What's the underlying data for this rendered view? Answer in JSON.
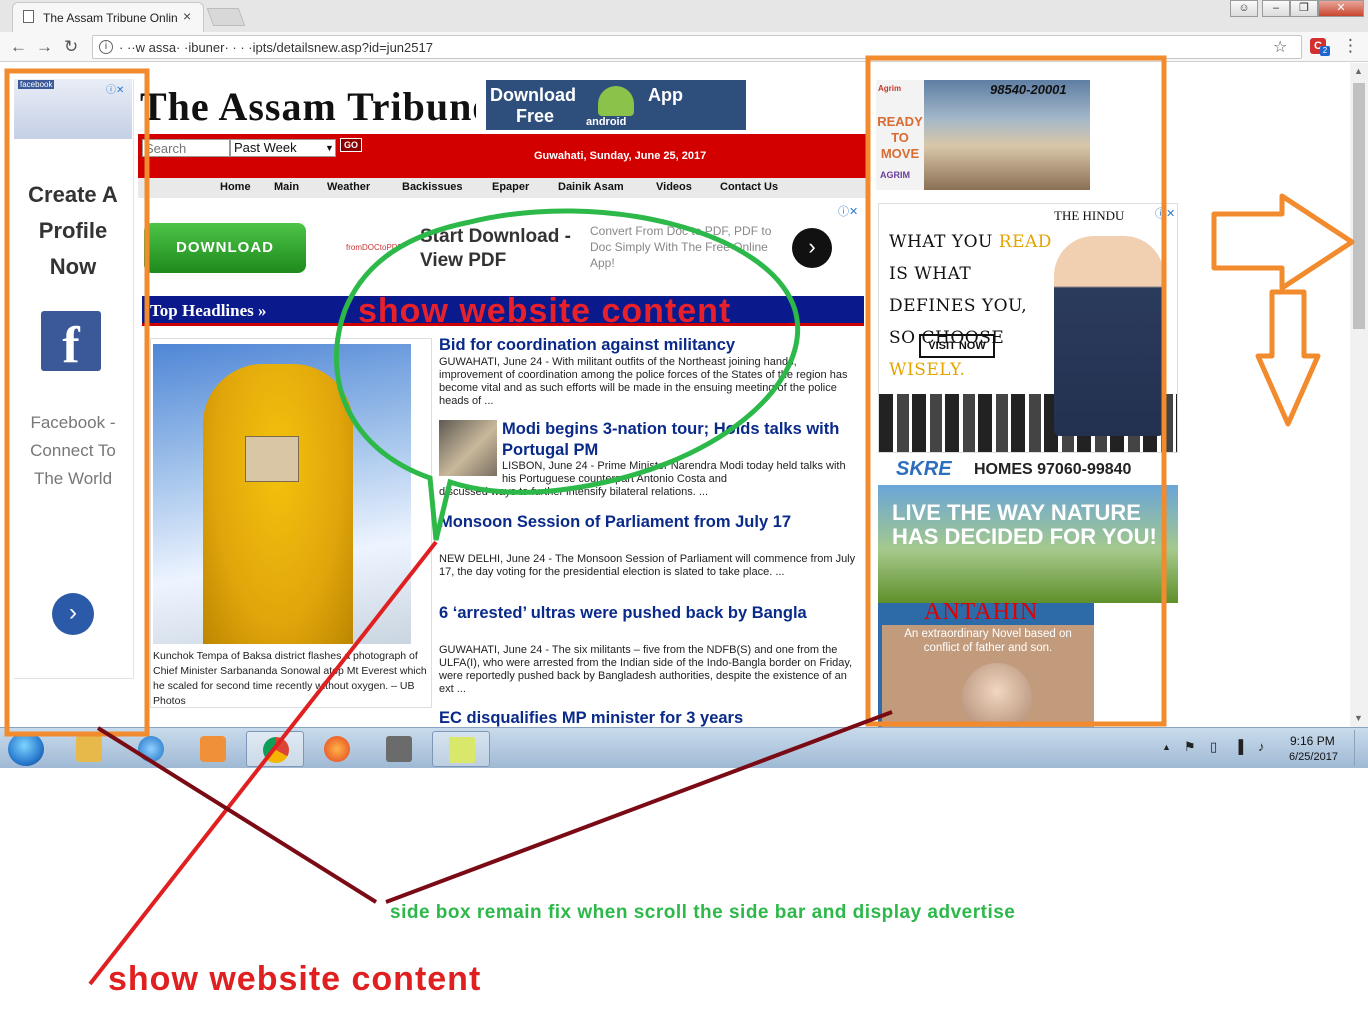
{
  "browser": {
    "tab_title": "The Assam Tribune Onlin",
    "url": "· ··w assa· ·ibuner· · · ·ipts/detailsnew.asp?id=jun2517",
    "tab_close": "×",
    "back": "←",
    "forward": "→",
    "reload": "↻",
    "info": "i",
    "star": "☆",
    "menu": "⋮",
    "ext_label": "C",
    "ext_badge": "2",
    "win_user": "☺",
    "win_min": "–",
    "win_max": "❐",
    "win_close": "✕"
  },
  "left_ad": {
    "brand": "facebook",
    "headline": "Create A Profile Now",
    "logo_letter": "f",
    "caption": "Facebook - Connect To The World",
    "adchoice": "ⓘ✕",
    "next": "›"
  },
  "masthead": {
    "logo": "The Assam Tribune",
    "app_download": "Download",
    "app_free": "Free",
    "app_app": "App",
    "app_android": "android",
    "search_placeholder": "Search",
    "period_selected": "Past Week",
    "period_arrow": "▼",
    "go_label": "GO",
    "dateline": "Guwahati, Sunday, June 25, 2017"
  },
  "nav": [
    "Home",
    "Main",
    "Weather",
    "Backissues",
    "Epaper",
    "Dainik Asam",
    "Videos",
    "Contact Us"
  ],
  "download_ad": {
    "button": "DOWNLOAD",
    "logo": "fromDOCtoPDF",
    "title": "Start Download - View PDF",
    "subtitle": "Convert From Doc to PDF, PDF to Doc Simply With The Free Online App!",
    "next": "›",
    "adchoice": "ⓘ✕"
  },
  "headlines_label": "Top Headlines »",
  "photo_caption": "Kunchok Tempa of Baksa district flashes a photograph of Chief Minister Sarbananda Sonowal atop Mt Everest which he scaled for second time recently without oxygen. – UB Photos",
  "stories": [
    {
      "title": "Bid for coordination against militancy",
      "body": "GUWAHATI, June 24 - With militant outfits of the Northeast joining hands, improvement of coordination among the police forces of the States of the region has become vital and as such efforts will be made in the ensuing meeting of the police heads of ..."
    },
    {
      "title": "Modi begins 3-nation tour; Holds talks with Portugal PM",
      "body": "LISBON, June 24 - Prime Minister Narendra Modi today held talks with his Portuguese counterpart Antonio Costa and",
      "body2": "discussed ways to further intensify bilateral relations. ..."
    },
    {
      "title": "Monsoon Session of Parliament from July 17",
      "body": "NEW DELHI, June 24 - The Monsoon Session of Parliament will commence from July 17, the day voting for the presidential election is slated to take place. ..."
    },
    {
      "title": "6 ‘arrested’ ultras were pushed back by Bangla",
      "body": "GUWAHATI, June 24 - The six militants – five from the NDFB(S) and one from the ULFA(I), who were arrested from the Indian side of the Indo-Bangla border on Friday, were reportedly pushed back by Bangladesh authorities, despite the existence of an ext ..."
    },
    {
      "title": "EC disqualifies MP minister for 3 years"
    }
  ],
  "right_ads": {
    "agrim_logo": "Agrim",
    "agrim_ready": "READY TO MOVE",
    "agrim_phone": "98540-20001",
    "agrim_brand": "AGRIM",
    "hindu_logo": "THE HINDU",
    "hindu_adchoice": "ⓘ✕",
    "hindu_w1": "WHAT YOU ",
    "hindu_w2": "READ",
    "hindu_w3": " IS WHAT DEFINES YOU, SO CHOOSE ",
    "hindu_w4": "WISELY.",
    "hindu_visit": "VISIT NOW",
    "skre_logo": "SKRE",
    "skre_text": "HOMES  97060-99840",
    "nature_text": "LIVE THE WAY NATURE HAS DECIDED FOR YOU!",
    "novel_title": "ANTAHIN",
    "novel_desc": "An extraordinary Novel based on conflict of father and son."
  },
  "taskbar": {
    "time": "9:16 PM",
    "date": "6/25/2017",
    "tray_up": "▲",
    "tray_flag": "⚑",
    "tray_battery": "▯",
    "tray_signal": "▐",
    "tray_volume": "♪"
  },
  "scroll": {
    "up": "▲",
    "down": "▼"
  },
  "annotations": {
    "green_label": "side box remain fix when scroll the side bar and display advertise",
    "red_label": "show website content",
    "red_label_top": "show website content"
  },
  "colors": {
    "annotation_orange": "#f28a2e",
    "annotation_green": "#2db84a",
    "annotation_red": "#e02020",
    "annotation_darkred": "#7a0a14",
    "masthead_red": "#d30000",
    "headline_navy": "#0a1a8c",
    "story_blue": "#0a2a8a"
  }
}
